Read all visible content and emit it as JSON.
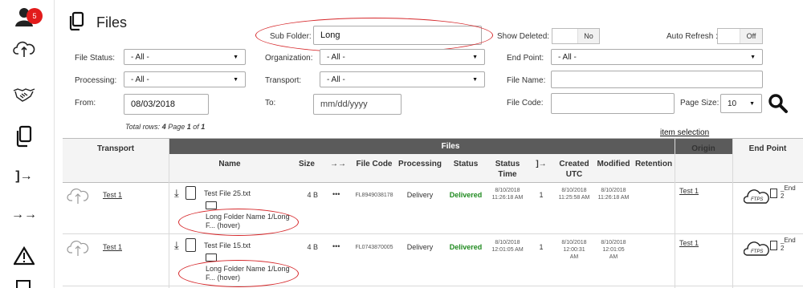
{
  "sidebar": {
    "badge_count": "5",
    "icons": [
      "user-icon",
      "cloud-sync-icon",
      "handshake-icon",
      "files-icon",
      "login-arrow-icon",
      "double-arrow-icon",
      "warning-icon"
    ]
  },
  "header": {
    "title": "Files"
  },
  "filters": {
    "sub_folder": {
      "label": "Sub Folder:",
      "value": "Long"
    },
    "show_deleted": {
      "label": "Show Deleted:",
      "value": "No"
    },
    "auto_refresh": {
      "label": "Auto Refresh :",
      "value": "Off"
    },
    "file_status": {
      "label": "File Status:",
      "value": "- All -"
    },
    "organization": {
      "label": "Organization:",
      "value": "- All -"
    },
    "end_point": {
      "label": "End Point:",
      "value": "- All -"
    },
    "processing": {
      "label": "Processing:",
      "value": "- All -"
    },
    "transport": {
      "label": "Transport:",
      "value": "- All -"
    },
    "file_name": {
      "label": "File Name:",
      "value": ""
    },
    "from": {
      "label": "From:",
      "value": "08/03/2018"
    },
    "to": {
      "label": "To:",
      "placeholder": "mm/dd/yyyy"
    },
    "file_code": {
      "label": "File Code:",
      "value": ""
    },
    "page_size": {
      "label": "Page Size:",
      "value": "10"
    }
  },
  "summary": {
    "prefix": "Total rows: ",
    "rows": "4",
    "mid": " Page ",
    "page": "1",
    "of": " of ",
    "pages": "1"
  },
  "item_selection": "item selection",
  "table": {
    "group_files": "Files",
    "headers": {
      "transport": "Transport",
      "name": "Name",
      "size": "Size",
      "dir": "→→",
      "file_code": "File Code",
      "processing": "Processing",
      "status": "Status",
      "status_time_1": "Status",
      "status_time_2": "Time",
      "tries": "]→",
      "created_1": "Created",
      "created_2": "UTC",
      "modified": "Modified",
      "retention": "Retention",
      "origin": "Origin",
      "end_point": "End Point"
    },
    "rows": [
      {
        "transport": "Test 1",
        "file_name": "Test File 25.txt",
        "folder_1": "Long Folder Name 1/Long",
        "folder_2": "F... (hover)",
        "size": "4 B",
        "dots": "•••",
        "file_code": "FL8949038178",
        "processing": "Delivery",
        "status": "Delivered",
        "status_time_1": "8/10/2018",
        "status_time_2": "11:26:18 AM",
        "tries": "1",
        "created_1": "8/10/2018",
        "created_2": "11:25:58 AM",
        "modified_1": "8/10/2018",
        "modified_2": "11:26:18 AM",
        "origin": "Test 1",
        "endpoint_text_1": "_End",
        "endpoint_text_2": "2"
      },
      {
        "transport": "Test 1",
        "file_name": "Test File 15.txt",
        "folder_1": "Long Folder Name 1/Long",
        "folder_2": "F... (hover)",
        "size": "4 B",
        "dots": "•••",
        "file_code": "FL0743870005",
        "processing": "Delivery",
        "status": "Delivered",
        "status_time_1": "8/10/2018",
        "status_time_2": "12:01:05 AM",
        "tries": "1",
        "created_1": "8/10/2018",
        "created_2": "12:00:31",
        "created_3": "AM",
        "modified_1": "8/10/2018",
        "modified_2": "12:01:05",
        "modified_3": "AM",
        "origin": "Test 1",
        "endpoint_text_1": "_End",
        "endpoint_text_2": "2"
      }
    ]
  }
}
